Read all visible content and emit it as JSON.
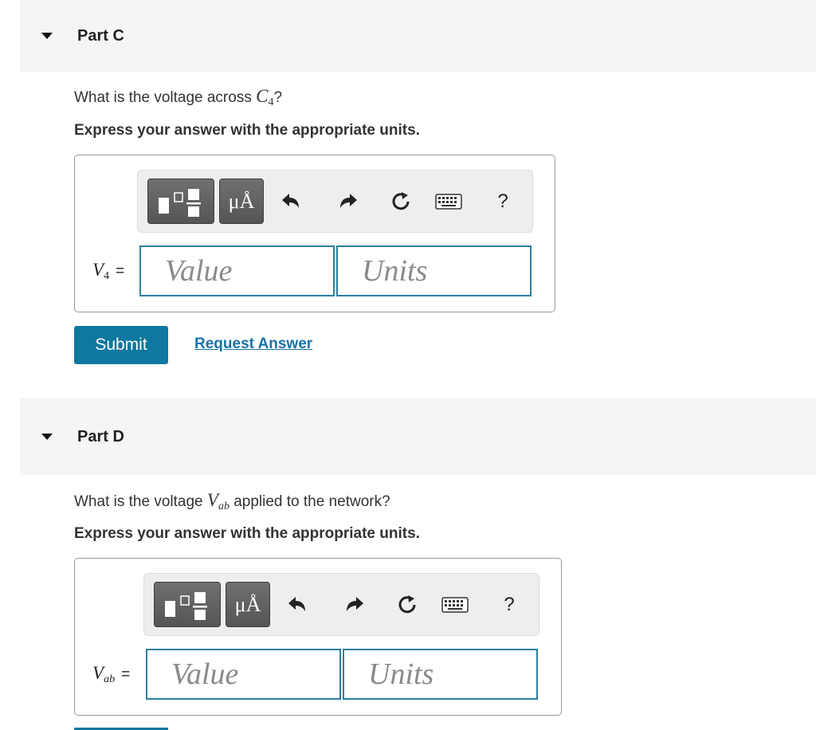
{
  "part_c": {
    "title": "Part C",
    "question_prefix": "What is the voltage across ",
    "question_var": "C",
    "question_sub": "4",
    "question_suffix": "?",
    "instruction": "Express your answer with the appropriate units.",
    "var_label": "V",
    "var_sub": "4",
    "equals": "=",
    "value_placeholder": "Value",
    "units_placeholder": "Units",
    "units_button_label": "μÅ",
    "help_label": "?",
    "submit_label": "Submit",
    "request_label": "Request Answer"
  },
  "part_d": {
    "title": "Part D",
    "question_prefix": "What is the voltage ",
    "question_var": "V",
    "question_sub": "ab",
    "question_suffix": " applied to the network?",
    "instruction": "Express your answer with the appropriate units.",
    "var_label": "V",
    "var_sub": "ab",
    "equals": "=",
    "value_placeholder": "Value",
    "units_placeholder": "Units",
    "units_button_label": "μÅ",
    "help_label": "?"
  },
  "colors": {
    "accent": "#0f78a0",
    "input_border": "#2a7fa1",
    "header_bg": "#f5f5f5"
  }
}
